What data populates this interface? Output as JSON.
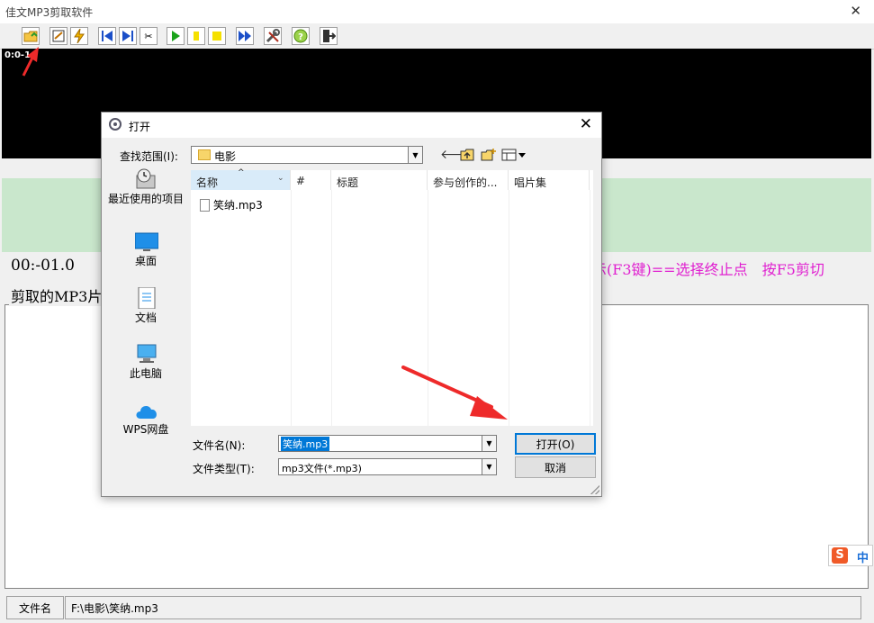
{
  "app": {
    "title": "佳文MP3剪取软件"
  },
  "toolbar": {
    "buttons": [
      "open-icon",
      "edit-icon",
      "lightning-icon",
      "skip-start-icon",
      "skip-end-icon",
      "scissors-icon",
      "play-icon",
      "pause-icon",
      "stop-icon",
      "fast-forward-icon",
      "tools-icon",
      "help-icon",
      "exit-icon"
    ]
  },
  "wave": {
    "position": "0:0-1"
  },
  "main": {
    "time": "00:-01.0",
    "hint": "示(F3键)==选择终止点　按F5剪切",
    "group_label": "剪取的MP3片"
  },
  "status": {
    "label": "文件名",
    "value": "F:\\电影\\笑纳.mp3"
  },
  "ime": {
    "s": "S",
    "mode": "中"
  },
  "dialog": {
    "title": "打开",
    "look_in_label": "查找范围(I):",
    "look_in_value": "电影",
    "places": [
      "最近使用的项目",
      "桌面",
      "文档",
      "此电脑",
      "WPS网盘"
    ],
    "columns": [
      "名称",
      "#",
      "标题",
      "参与创作的...",
      "唱片集"
    ],
    "files": [
      "笑纳.mp3"
    ],
    "filename_label": "文件名(N):",
    "filename_value": "笑纳.mp3",
    "filetype_label": "文件类型(T):",
    "filetype_value": "mp3文件(*.mp3)",
    "open_button": "打开(O)",
    "cancel_button": "取消"
  },
  "colors": {
    "accent": "#0078d7",
    "hint": "#e020d0",
    "green_panel": "#c9e7cc",
    "annotation_arrow": "#ee2a2a"
  }
}
